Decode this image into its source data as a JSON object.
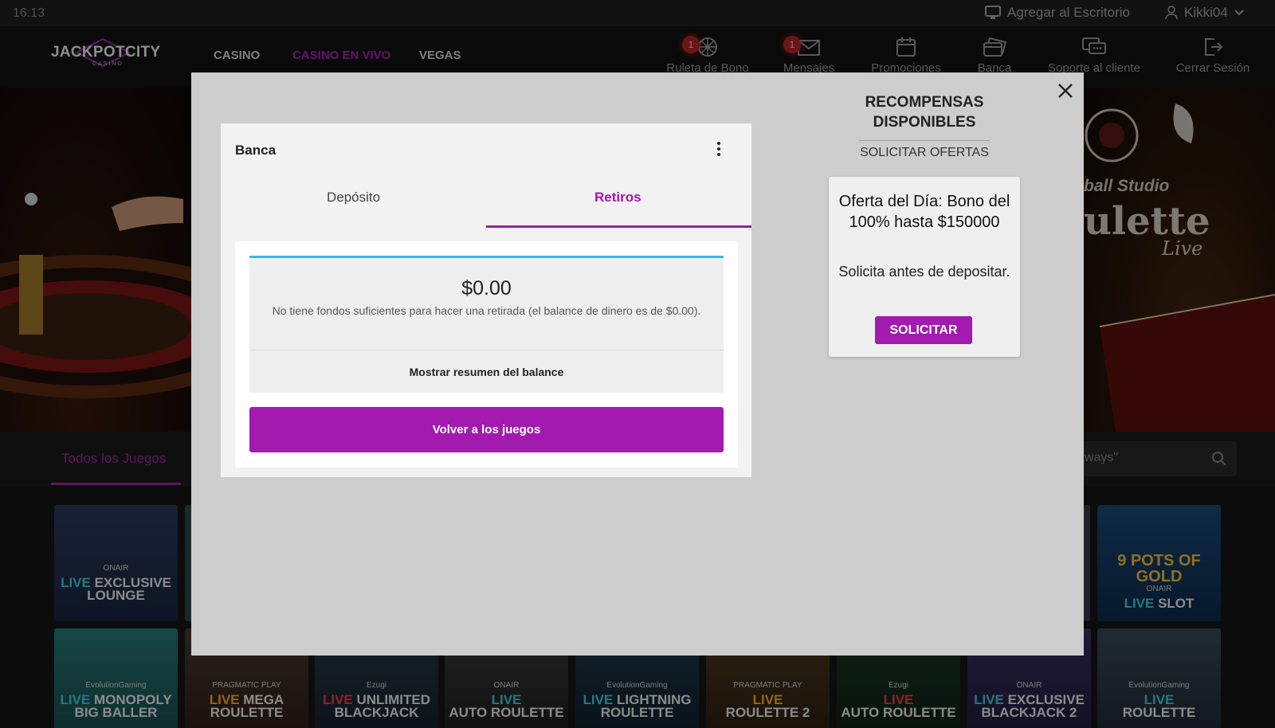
{
  "status_bar": {
    "time": "16:13",
    "add_to_desktop": "Agregar al Escritorio",
    "username": "Kikki04"
  },
  "header": {
    "logo_text": "JACKPOTCITY",
    "logo_sub": "CASINO",
    "nav": [
      "CASINO",
      "CASINO EN VIVO",
      "VEGAS"
    ],
    "active_nav": "CASINO EN VIVO",
    "icons": [
      {
        "label": "Ruleta de Bono",
        "icon": "wheel-icon",
        "badge": "1"
      },
      {
        "label": "Mensajes",
        "icon": "envelope-icon",
        "badge": "1"
      },
      {
        "label": "Promociones",
        "icon": "calendar-icon"
      },
      {
        "label": "Banca",
        "icon": "cards-icon"
      },
      {
        "label": "Soporte al cliente",
        "icon": "chat-icon"
      },
      {
        "label": "Cerrar Sesión",
        "icon": "logout-icon"
      }
    ]
  },
  "hero": {
    "right_studio": "ball Studio",
    "right_title": "ulette",
    "right_live": "Live"
  },
  "filters": {
    "all_games": "Todos los Juegos",
    "search_placeholder": "aways\""
  },
  "tiles": [
    {
      "l1": "LIVE EXCLUSIVE",
      "l2": "LOUNGE",
      "brand": "ONAIR"
    },
    {
      "l1": "LIVE SLOT",
      "l2": "9 POTS OF GOLD",
      "brand": "ONAIR"
    },
    {
      "l1": "LIVE MONOPOLY",
      "l2": "BIG BALLER",
      "brand": "EvolutionGaming"
    },
    {
      "l1": "LIVE MEGA",
      "l2": "ROULETTE",
      "brand": "PRAGMATIC PLAY"
    },
    {
      "l1": "LIVE UNLIMITED",
      "l2": "BLACKJACK",
      "brand": "Ezugi"
    },
    {
      "l1": "LIVE",
      "l2": "AUTO ROULETTE",
      "brand": "ONAIR"
    },
    {
      "l1": "LIVE LIGHTNING",
      "l2": "ROULETTE",
      "brand": "EvolutionGaming"
    },
    {
      "l1": "LIVE",
      "l2": "ROULETTE 2",
      "brand": "PRAGMATIC PLAY"
    },
    {
      "l1": "LIVE",
      "l2": "AUTO ROULETTE",
      "brand": "Ezugi"
    },
    {
      "l1": "LIVE EXCLUSIVE",
      "l2": "BLACKJACK 2",
      "brand": "ONAIR"
    },
    {
      "l1": "LIVE",
      "l2": "ROULETTE",
      "brand": "EvolutionGaming"
    }
  ],
  "modal": {
    "panel_title": "Banca",
    "tabs": [
      "Depósito",
      "Retiros"
    ],
    "active_tab": "Retiros",
    "amount": "$0.00",
    "message": "No tiene fondos suficientes para hacer una retirada (el balance de dinero es de $0.00).",
    "summary_link": "Mostrar resumen del balance",
    "back_button": "Volver a los juegos",
    "rewards_title": "RECOMPENSAS DISPONIBLES",
    "rewards_subtitle": "SOLICITAR OFERTAS",
    "offer_headline": "Oferta del Día: Bono del 100% hasta $150000",
    "offer_body": "Solicita antes de depositar.",
    "offer_button": "SOLICITAR"
  },
  "colors": {
    "accent": "#a21aae",
    "active_tab_line": "#9e1aaa",
    "balance_top_border": "#3ab6e6",
    "badge": "#b5262a"
  }
}
